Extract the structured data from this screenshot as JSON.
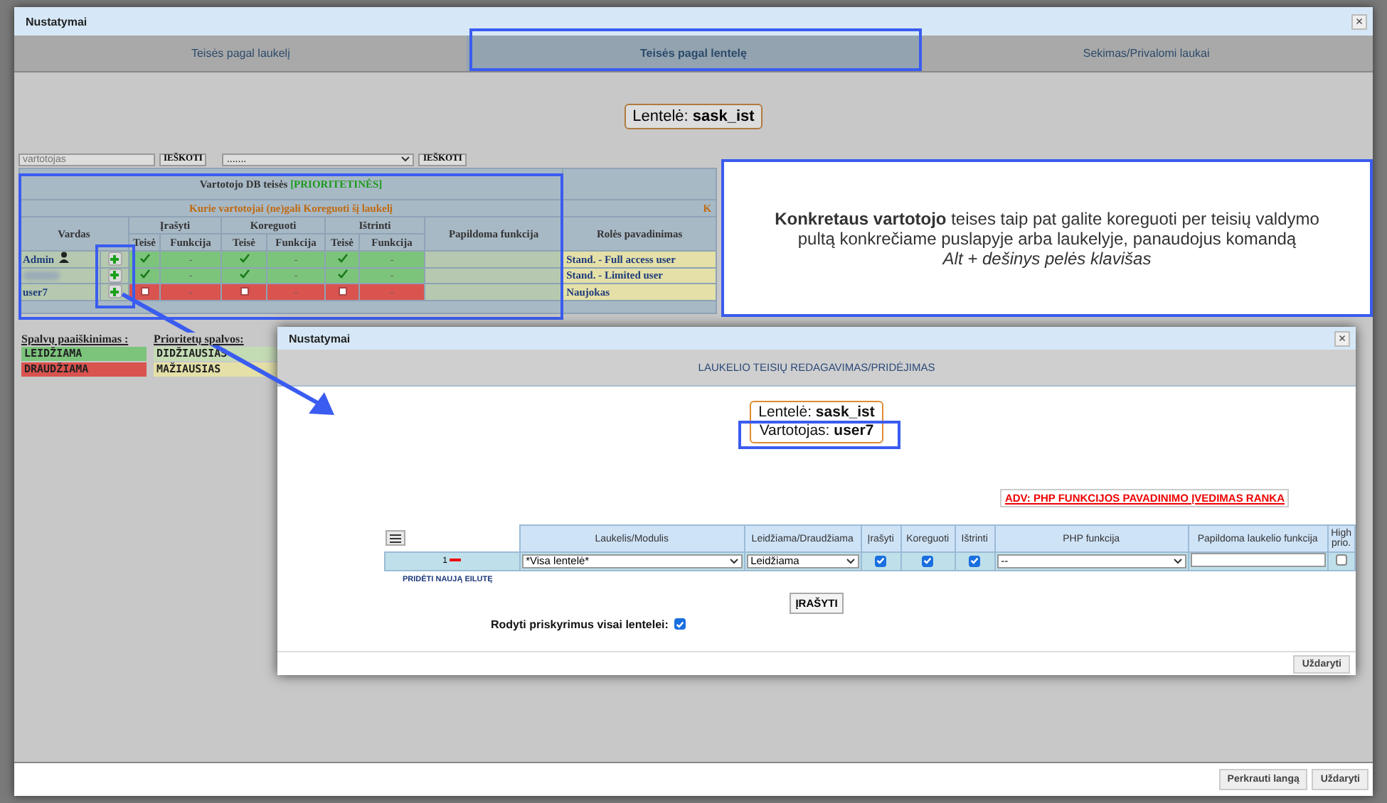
{
  "window": {
    "title": "Nustatymai",
    "close": "×"
  },
  "tabs": [
    {
      "label": "Teisės pagal laukelį",
      "selected": false
    },
    {
      "label": "Teisės pagal lentelę",
      "selected": true
    },
    {
      "label": "Sekimas/Privalomi laukai",
      "selected": false
    }
  ],
  "table_label": {
    "label": "Lentelė:",
    "value": "sask_ist"
  },
  "search": {
    "placeholder": "vartotojas",
    "button": "IEŠKOTI"
  },
  "filter": {
    "value": ".......",
    "button": "IEŠKOTI"
  },
  "permissions": {
    "title": "Vartotojo DB teisės",
    "title_tag": "[PRIORITETINĖS]",
    "subtitle": "Kurie vartotojai (ne)gali Koreguoti šį laukelį",
    "role_subtitle": "K",
    "name_header": "Vardas",
    "groups": [
      {
        "label": "Įrašyti",
        "right_header": "Teisė",
        "function_header": "Funkcija"
      },
      {
        "label": "Koreguoti",
        "right_header": "Teisė",
        "function_header": "Funkcija"
      },
      {
        "label": "Ištrinti",
        "right_header": "Teisė",
        "function_header": "Funkcija"
      }
    ],
    "extra_header": "Papildoma funkcija",
    "role_header": "Rolės pavadinimas",
    "rows": [
      {
        "name": "Admin",
        "admin_icon": true,
        "allowed": true,
        "perms": [
          {
            "granted": true,
            "function": "-"
          },
          {
            "granted": true,
            "function": "-"
          },
          {
            "granted": true,
            "function": "-"
          }
        ],
        "role": "Stand. - Full access user"
      },
      {
        "name_blurred": true,
        "admin_icon": false,
        "allowed": true,
        "perms": [
          {
            "granted": true,
            "function": "-"
          },
          {
            "granted": true,
            "function": "-"
          },
          {
            "granted": true,
            "function": "-"
          }
        ],
        "role": "Stand. - Limited user"
      },
      {
        "name": "user7",
        "admin_icon": false,
        "allowed": false,
        "perms": [
          {
            "granted": false,
            "function": "-"
          },
          {
            "granted": false,
            "function": "-"
          },
          {
            "granted": false,
            "function": "-"
          }
        ],
        "role": "Naujokas"
      }
    ]
  },
  "legend": [
    {
      "title": "Spalvų paaiškinimas :",
      "items": [
        {
          "label": "LEIDŽIAMA",
          "color": "#7cc47c"
        },
        {
          "label": "DRAUDŽIAMA",
          "color": "#d9534f"
        }
      ]
    },
    {
      "title": "Prioritetų spalvos:",
      "items": [
        {
          "label": "DIDŽIAUSIAS",
          "color": "#c4dcb4"
        },
        {
          "label": "MAŽIAUSIAS",
          "color": "#e4e0a8"
        }
      ]
    }
  ],
  "callout": {
    "text": "**Konkretaus vartotojo** teises taip pat galite koreguoti per teisių valdymo pultą konkrečiame puslapyje arba laukelyje, panaudojus komandą",
    "shortcut": "Alt + dešinys pelės klavišas"
  },
  "dialog": {
    "title": "Nustatymai",
    "close": "×",
    "header": "LAUKELIO TEISIŲ REDAGAVIMAS/PRIDĖJIMAS",
    "table_label": {
      "label": "Lentelė:",
      "value": "sask_ist"
    },
    "user_label": {
      "label": "Vartotojas:",
      "value": "user7"
    },
    "adv_link": "ADV: PHP FUNKCIJOS PAVADINIMO ĮVEDIMAS RANKA",
    "columns": [
      "Laukelis/Modulis",
      "Leidžiama/Draudžiama",
      "Įrašyti",
      "Koreguoti",
      "Ištrinti",
      "PHP funkcija",
      "Papildoma laukelio funkcija",
      "High prio."
    ],
    "rows": [
      {
        "index": "1",
        "field": "*Visa lentelė*",
        "access": "Leidžiama",
        "write": true,
        "edit": true,
        "delete": true,
        "php": "--",
        "high_prio": false
      }
    ],
    "add_row": "PRIDĖTI NAUJĄ EILUTĘ",
    "save": "ĮRAŠYTI",
    "show_all": {
      "label": "Rodyti priskyrimus visai lentelei:",
      "checked": true
    },
    "close_button": "Uždaryti"
  },
  "footer": {
    "buttons": [
      "Perkrauti langą",
      "Uždaryti"
    ]
  }
}
